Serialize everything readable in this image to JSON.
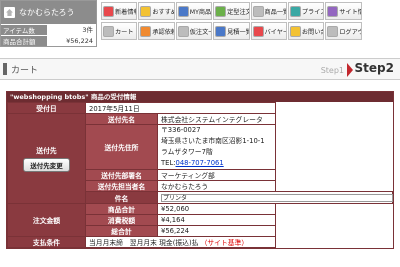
{
  "user_panel": {
    "name": "なかむらたろう",
    "items_label": "アイテム数",
    "items_value": "3件",
    "total_label": "商品合計額",
    "total_value": "¥56,224"
  },
  "nav": {
    "items": [
      {
        "label": "新着情報",
        "icon": "news-icon",
        "color": "#e8484c"
      },
      {
        "label": "おすすめ",
        "icon": "recommend-icon",
        "color": "#f3c233"
      },
      {
        "label": "MY商品",
        "icon": "my-products-icon",
        "color": "#4a78c8"
      },
      {
        "label": "定型注文",
        "icon": "standard-order-icon",
        "color": "#6bb04a"
      },
      {
        "label": "商品一覧",
        "icon": "product-list-icon",
        "color": "#bcbcbc"
      },
      {
        "label": "プライスリスト",
        "icon": "price-list-icon",
        "color": "#3aa8a4"
      },
      {
        "label": "サイト情報",
        "icon": "site-info-icon",
        "color": "#9366c0"
      },
      {
        "label": "",
        "icon": "blank-icon",
        "color": "#ffffff"
      },
      {
        "label": "カート",
        "icon": "cart-icon",
        "color": "#bcbcbc"
      },
      {
        "label": "承認依頼",
        "icon": "approval-icon",
        "color": "#f08a30"
      },
      {
        "label": "仮注文一覧",
        "icon": "draft-order-icon",
        "color": "#bcbcbc"
      },
      {
        "label": "見積一覧",
        "icon": "quote-list-icon",
        "color": "#4a78c8"
      },
      {
        "label": "バイヤー情報",
        "icon": "buyer-info-icon",
        "color": "#e8484c"
      },
      {
        "label": "お問い合せ",
        "icon": "contact-icon",
        "color": "#f3c233"
      },
      {
        "label": "ログアウト",
        "icon": "logout-icon",
        "color": "#bcbcbc"
      }
    ]
  },
  "cart": {
    "title": "カート",
    "step1": "Step1",
    "step2": "Step2"
  },
  "order": {
    "header": "\"webshopping btobs\" 商品の受付情報",
    "labels": {
      "received_date": "受付日",
      "ship_to": "送付先",
      "change_address_button": "送付先変更",
      "ship_company": "送付先名",
      "ship_address": "送付先住所",
      "ship_dept": "送付先部署名",
      "ship_person": "送付先担当者名",
      "subject": "件名",
      "order_amount": "注文金額",
      "subtotal": "商品合計",
      "tax": "消費税額",
      "total": "総合計",
      "payment": "支払条件"
    },
    "values": {
      "received_date": "2017年5月11日",
      "ship_company": "株式会社システムインテグレータ",
      "postal": "〒336-0027",
      "address": "埼玉県さいたま市南区沼影1-10-1　ラムザタワー7階",
      "tel_label": "TEL:",
      "tel": "048-707-7061",
      "ship_dept": "マーケティング部",
      "ship_person": "なかむらたろう",
      "subject": "プリンタ",
      "subtotal": "¥52,060",
      "tax": "¥4,164",
      "total": "¥56,224",
      "payment": "当月月末締　翌月月末 現金(振込)払",
      "payment_note": "（サイト基準）"
    }
  }
}
